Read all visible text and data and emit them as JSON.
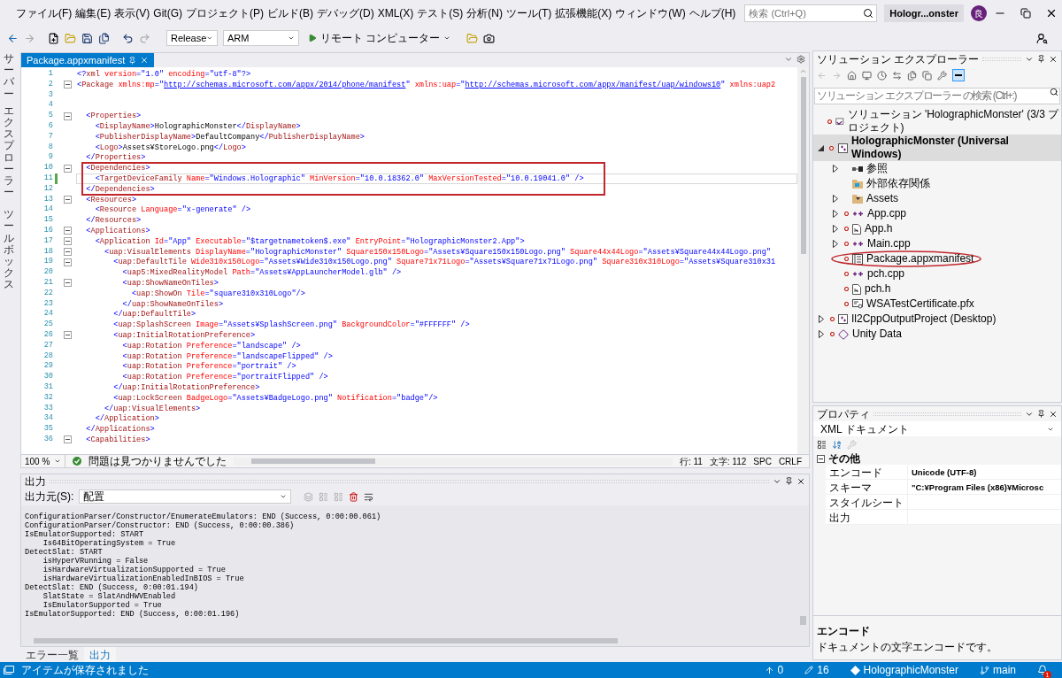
{
  "menu_bar": {
    "items": [
      "ファイル(F)",
      "編集(E)",
      "表示(V)",
      "Git(G)",
      "プロジェクト(P)",
      "ビルド(B)",
      "デバッグ(D)",
      "XML(X)",
      "テスト(S)",
      "分析(N)",
      "ツール(T)",
      "拡張機能(X)",
      "ウィンドウ(W)",
      "ヘルプ(H)"
    ],
    "search": {
      "placeholder": "検索 (Ctrl+Q)"
    },
    "solution_title": "Hologr...onster",
    "avatar": "良"
  },
  "toolbar": {
    "configuration": "Release",
    "platform": "ARM",
    "run_target": "リモート コンピューター"
  },
  "side_tabs": [
    [
      "サーバー",
      "エクスプローラー"
    ],
    [
      "ツールボックス"
    ]
  ],
  "editor": {
    "tabs": [
      {
        "label": "Package.appxmanifest",
        "selected": true
      }
    ],
    "lines": [
      {
        "number": "1",
        "text": "<?xml version=\"1.0\" encoding=\"utf-8\"?>",
        "fold": false,
        "changed": false,
        "current": false,
        "boxed": false
      },
      {
        "number": "2",
        "text": "<Package xmlns:mp=\"http://schemas.microsoft.com/appx/2014/phone/manifest\" xmlns:uap=\"http://schemas.microsoft.com/appx/manifest/uap/windows10\" xmlns:uap2",
        "fold": true,
        "changed": false,
        "current": false,
        "boxed": false
      },
      {
        "number": "3",
        "fold": false,
        "changed": false,
        "current": false,
        "boxed": false
      },
      {
        "number": "4",
        "fold": false,
        "changed": false,
        "current": false,
        "boxed": false
      },
      {
        "number": "5",
        "text": "  <Properties>",
        "fold": true,
        "changed": false,
        "current": false,
        "boxed": false
      },
      {
        "number": "6",
        "text": "    <DisplayName>HolographicMonster</DisplayName>",
        "fold": false,
        "changed": false,
        "current": false,
        "boxed": false
      },
      {
        "number": "7",
        "text": "    <PublisherDisplayName>DefaultCompany</PublisherDisplayName>",
        "fold": false,
        "changed": false,
        "current": false,
        "boxed": false
      },
      {
        "number": "8",
        "text": "    <Logo>Assets¥StoreLogo.png</Logo>",
        "fold": false,
        "changed": false,
        "current": false,
        "boxed": false
      },
      {
        "number": "9",
        "text": "  </Properties>",
        "fold": false,
        "changed": false,
        "current": false,
        "boxed": false
      },
      {
        "number": "10",
        "text": "  <Dependencies>",
        "fold": true,
        "changed": false,
        "current": false,
        "boxed": true
      },
      {
        "number": "11",
        "text": "    <TargetDeviceFamily Name=\"Windows.Holographic\" MinVersion=\"10.0.18362.0\" MaxVersionTested=\"10.0.19041.0\" />",
        "fold": false,
        "changed": true,
        "current": true,
        "boxed": true
      },
      {
        "number": "12",
        "text": "  </Dependencies>",
        "fold": false,
        "changed": false,
        "current": false,
        "boxed": true
      },
      {
        "number": "13",
        "text": "  <Resources>",
        "fold": true,
        "changed": false,
        "current": false,
        "boxed": false
      },
      {
        "number": "14",
        "text": "    <Resource Language=\"x-generate\" />",
        "fold": false,
        "changed": false,
        "current": false,
        "boxed": false
      },
      {
        "number": "15",
        "text": "  </Resources>",
        "fold": false,
        "changed": false,
        "current": false,
        "boxed": false
      },
      {
        "number": "16",
        "text": "  <Applications>",
        "fold": true,
        "changed": false,
        "current": false,
        "boxed": false
      },
      {
        "number": "17",
        "text": "    <Application Id=\"App\" Executable=\"$targetnametoken$.exe\" EntryPoint=\"HolographicMonster2.App\">",
        "fold": true,
        "changed": false,
        "current": false,
        "boxed": false
      },
      {
        "number": "18",
        "text": "      <uap:VisualElements DisplayName=\"HolographicMonster\" Square150x150Logo=\"Assets¥Square150x150Logo.png\" Square44x44Logo=\"Assets¥Square44x44Logo.png\"",
        "fold": true,
        "changed": false,
        "current": false,
        "boxed": false
      },
      {
        "number": "19",
        "text": "        <uap:DefaultTile Wide310x150Logo=\"Assets¥Wide310x150Logo.png\" Square71x71Logo=\"Assets¥Square71x71Logo.png\" Square310x310Logo=\"Assets¥Square310x31",
        "fold": true,
        "changed": false,
        "current": false,
        "boxed": false
      },
      {
        "number": "20",
        "text": "          <uap5:MixedRealityModel Path=\"Assets¥AppLauncherModel.glb\" />",
        "fold": false,
        "changed": false,
        "current": false,
        "boxed": false
      },
      {
        "number": "21",
        "text": "          <uap:ShowNameOnTiles>",
        "fold": true,
        "changed": false,
        "current": false,
        "boxed": false
      },
      {
        "number": "22",
        "text": "            <uap:ShowOn Tile=\"square310x310Logo\"/>",
        "fold": false,
        "changed": false,
        "current": false,
        "boxed": false
      },
      {
        "number": "23",
        "text": "          </uap:ShowNameOnTiles>",
        "fold": false,
        "changed": false,
        "current": false,
        "boxed": false
      },
      {
        "number": "24",
        "text": "        </uap:DefaultTile>",
        "fold": false,
        "changed": false,
        "current": false,
        "boxed": false
      },
      {
        "number": "25",
        "text": "        <uap:SplashScreen Image=\"Assets¥SplashScreen.png\" BackgroundColor=\"#FFFFFF\" />",
        "fold": false,
        "changed": false,
        "current": false,
        "boxed": false
      },
      {
        "number": "26",
        "text": "        <uap:InitialRotationPreference>",
        "fold": true,
        "changed": false,
        "current": false,
        "boxed": false
      },
      {
        "number": "27",
        "text": "          <uap:Rotation Preference=\"landscape\" />",
        "fold": false,
        "changed": false,
        "current": false,
        "boxed": false
      },
      {
        "number": "28",
        "text": "          <uap:Rotation Preference=\"landscapeFlipped\" />",
        "fold": false,
        "changed": false,
        "current": false,
        "boxed": false
      },
      {
        "number": "29",
        "text": "          <uap:Rotation Preference=\"portrait\" />",
        "fold": false,
        "changed": false,
        "current": false,
        "boxed": false
      },
      {
        "number": "30",
        "text": "          <uap:Rotation Preference=\"portraitFlipped\" />",
        "fold": false,
        "changed": false,
        "current": false,
        "boxed": false
      },
      {
        "number": "31",
        "text": "        </uap:InitialRotationPreference>",
        "fold": false,
        "changed": false,
        "current": false,
        "boxed": false
      },
      {
        "number": "32",
        "text": "        <uap:LockScreen BadgeLogo=\"Assets¥BadgeLogo.png\" Notification=\"badge\"/>",
        "fold": false,
        "changed": false,
        "current": false,
        "boxed": false
      },
      {
        "number": "33",
        "text": "      </uap:VisualElements>",
        "fold": false,
        "changed": false,
        "current": false,
        "boxed": false
      },
      {
        "number": "34",
        "text": "    </Application>",
        "fold": false,
        "changed": false,
        "current": false,
        "boxed": false
      },
      {
        "number": "35",
        "text": "  </Applications>",
        "fold": false,
        "changed": false,
        "current": false,
        "boxed": false
      },
      {
        "number": "36",
        "text": "  <Capabilities>",
        "fold": true,
        "changed": false,
        "current": false,
        "boxed": false
      }
    ],
    "status": {
      "zoom": "100 %",
      "issues": "問題は見つかりませんでした",
      "line": "行: 11",
      "column": "文字: 112",
      "indent": "SPC",
      "line_ending": "CRLF"
    }
  },
  "output": {
    "title": "出力",
    "source_label": "出力元(S):",
    "source": "配置",
    "lines": [
      "ConfigurationParser/Constructor/EnumerateEmulators: END (Success, 0:00:00.061)",
      "ConfigurationParser/Constructor: END (Success, 0:00:00.386)",
      "IsEmulatorSupported: START",
      "    Is64BitOperatingSystem = True",
      "DetectSlat: START",
      "    isHyperVRunning = False",
      "    isHardwareVirtualizationSupported = True",
      "    isHardwareVirtualizationEnabledInBIOS = True",
      "DetectSlat: END (Success, 0:00:01.194)",
      "    SlatState = SlatAndHWVEnabled",
      "    IsEmulatorSupported = True",
      "IsEmulatorSupported: END (Success, 0:00:01.196)"
    ]
  },
  "bottom_tabs": [
    {
      "label": "エラー一覧",
      "selected": false
    },
    {
      "label": "出力",
      "selected": true
    }
  ],
  "solution_explorer": {
    "title": "ソリューション エクスプローラー",
    "search": {
      "placeholder": "ソリューション エクスプローラー の検索 (Ctrl+:)"
    },
    "items": [
      {
        "label": "ソリューション 'HolographicMonster' (3/3 プロジェクト)",
        "kind": "solution",
        "tracked": true,
        "selected": false,
        "circled": false
      },
      {
        "label": "HolographicMonster (Universal Windows)",
        "kind": "project",
        "tracked": true,
        "selected": true,
        "circled": false,
        "expanded": true,
        "children": [
          {
            "label": "参照",
            "kind": "references",
            "tracked": false,
            "selected": false,
            "circled": false,
            "expanded": false
          },
          {
            "label": "外部依存関係",
            "kind": "external",
            "tracked": false,
            "selected": false,
            "circled": false
          },
          {
            "label": "Assets",
            "kind": "folder",
            "tracked": false,
            "selected": false,
            "circled": false,
            "expanded": false
          },
          {
            "label": "App.cpp",
            "kind": "cpp",
            "tracked": true,
            "selected": false,
            "circled": false,
            "expanded": false
          },
          {
            "label": "App.h",
            "kind": "header",
            "tracked": true,
            "selected": false,
            "circled": false,
            "expanded": false
          },
          {
            "label": "Main.cpp",
            "kind": "cpp",
            "tracked": true,
            "selected": false,
            "circled": false,
            "expanded": false
          },
          {
            "label": "Package.appxmanifest",
            "kind": "manifest",
            "tracked": true,
            "selected": false,
            "circled": true
          },
          {
            "label": "pch.cpp",
            "kind": "cpp",
            "tracked": true,
            "selected": false,
            "circled": false
          },
          {
            "label": "pch.h",
            "kind": "header",
            "tracked": true,
            "selected": false,
            "circled": false
          },
          {
            "label": "WSATestCertificate.pfx",
            "kind": "certificate",
            "tracked": true,
            "selected": false,
            "circled": false
          }
        ]
      },
      {
        "label": "Il2CppOutputProject (Desktop)",
        "kind": "project",
        "tracked": true,
        "selected": false,
        "circled": false,
        "expanded": false
      },
      {
        "label": "Unity Data",
        "kind": "unity",
        "tracked": true,
        "selected": false,
        "circled": false,
        "expanded": false
      }
    ]
  },
  "properties": {
    "title": "プロパティ",
    "object": "XML ドキュメント",
    "category": {
      "label": "その他",
      "expanded": true
    },
    "rows": [
      {
        "name": "エンコード",
        "value": "Unicode (UTF-8)"
      },
      {
        "name": "スキーマ",
        "value": "\"C:¥Program Files (x86)¥Microsc"
      },
      {
        "name": "スタイルシート"
      },
      {
        "name": "出力"
      }
    ],
    "description_title": "エンコード",
    "description": "ドキュメントの文字エンコードです。"
  },
  "status_bar": {
    "message": "アイテムが保存されました",
    "items": [
      {
        "kind": "push",
        "text": "0"
      },
      {
        "kind": "changes",
        "text": "16"
      },
      {
        "kind": "repository",
        "text": "HolographicMonster"
      },
      {
        "kind": "branch",
        "text": "main"
      }
    ],
    "notifications": "1"
  }
}
